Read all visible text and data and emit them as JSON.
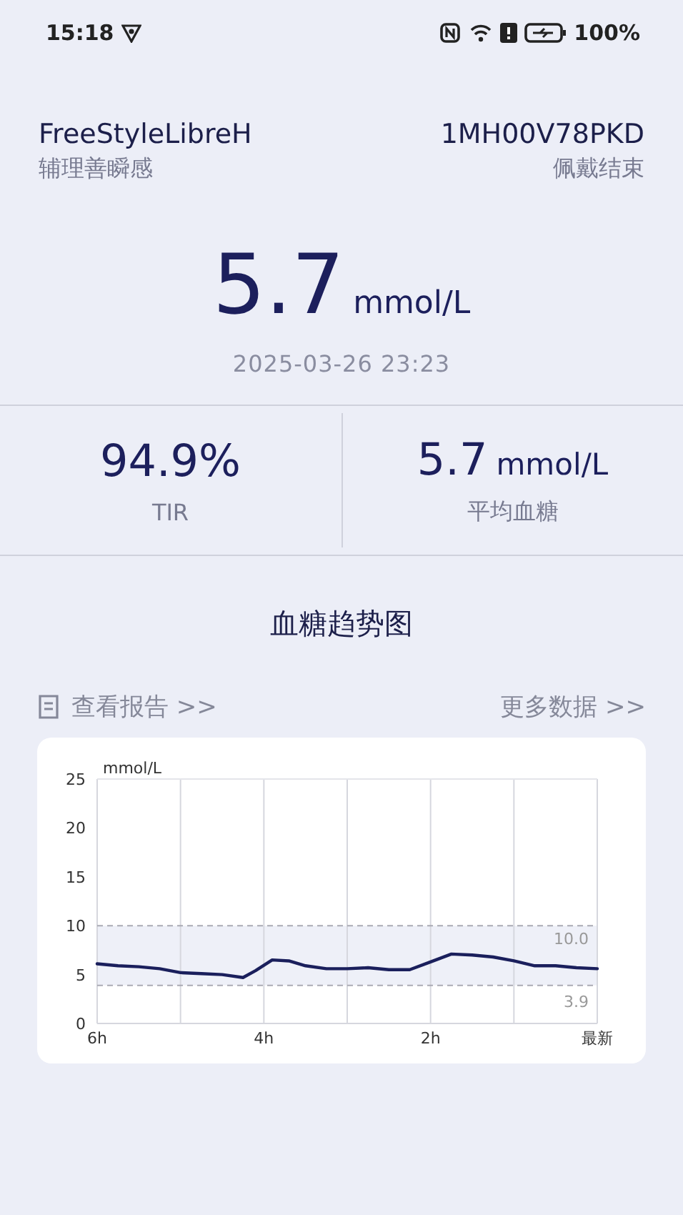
{
  "status_bar": {
    "time": "15:18",
    "battery": "100%"
  },
  "device": {
    "name": "FreeStyleLibreH",
    "serial": "1MH00V78PKD",
    "brand": "辅理善瞬感",
    "state": "佩戴结束"
  },
  "reading": {
    "value": "5.7",
    "unit": "mmol/L",
    "time": "2025-03-26 23:23"
  },
  "stats": [
    {
      "value": "94.9%",
      "label": "TIR"
    },
    {
      "value": "5.7",
      "unit": "mmol/L",
      "label": "平均血糖"
    }
  ],
  "trend": {
    "title": "血糖趋势图",
    "report_link": "查看报告 >>",
    "more_link": "更多数据 >>",
    "chart_data": {
      "type": "line",
      "ylabel": "mmol/L",
      "x": [
        -6,
        -5.75,
        -5.5,
        -5.25,
        -5,
        -4.75,
        -4.5,
        -4.25,
        -4.1,
        -3.9,
        -3.7,
        -3.5,
        -3.25,
        -3,
        -2.75,
        -2.5,
        -2.25,
        -2,
        -1.75,
        -1.5,
        -1.25,
        -1,
        -0.75,
        -0.5,
        -0.25,
        0
      ],
      "series": [
        {
          "color": "#1a1f5c",
          "values": [
            6.1,
            5.9,
            5.8,
            5.6,
            5.2,
            5.1,
            5.0,
            4.7,
            5.4,
            6.5,
            6.4,
            5.9,
            5.6,
            5.6,
            5.7,
            5.5,
            5.5,
            6.3,
            7.1,
            7.0,
            6.8,
            6.4,
            5.9,
            5.9,
            5.7,
            5.6
          ]
        }
      ],
      "xlim": [
        -6,
        0
      ],
      "ylim": [
        0,
        25
      ],
      "xticks": [
        {
          "value": -6,
          "label": "6h"
        },
        {
          "value": -4,
          "label": "4h"
        },
        {
          "value": -2,
          "label": "2h"
        },
        {
          "value": 0,
          "label": "最新"
        }
      ],
      "yticks": [
        0,
        5,
        10,
        15,
        20,
        25
      ],
      "ref_lines": [
        {
          "axis": "y",
          "value": 10,
          "label": "10.0"
        },
        {
          "axis": "y",
          "value": 3.9,
          "label": "3.9"
        }
      ],
      "bands": [
        {
          "axis": "y",
          "from": 3.9,
          "to": 10
        }
      ]
    }
  }
}
